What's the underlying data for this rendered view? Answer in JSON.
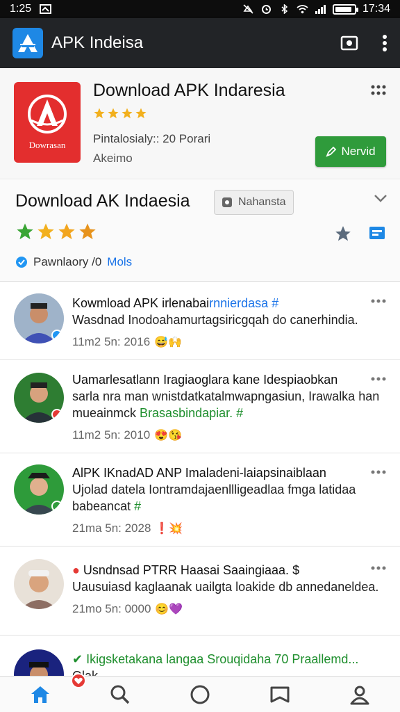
{
  "status_bar": {
    "time_left": "1:25",
    "time_right": "17:34",
    "battery_level": 0.9
  },
  "app_bar": {
    "title": "APK Indeisa",
    "icons": [
      "app-logo-icon",
      "screen-icon",
      "overflow-menu-icon"
    ]
  },
  "header": {
    "title": "Download APK Indaresia",
    "icon_caption": "Dowrasan",
    "rating": 4,
    "subtitle_1": "Pintalosialy:: 20 Porari",
    "subtitle_2": "Akeimo",
    "install_label": "Nervid"
  },
  "info": {
    "title": "Download AK Indaesia",
    "chip_label": "Nahansta",
    "rating": 4,
    "verified_text": "Pawnlaory /0",
    "verified_link": "Mols"
  },
  "posts": [
    {
      "title": "Kowmload APK irlenabai",
      "title_link": "rnnierdasa",
      "text": "Wasdnad Inodoahamurtagsiricgqah do canerhindia.",
      "meta": "11m2 5n: 2016",
      "emoji": "😅🙌"
    },
    {
      "title": "Uamarlesatlann Iragiaoglara kane Idespiaobkan",
      "text": "sarla nra man wnistdatkatalmwapngasiun, Irawalka han mueainmck",
      "text_link": "Brasasbindapiar.",
      "meta": "11m2 5n: 2010",
      "emoji": "😍😘"
    },
    {
      "title": "AlPK IKnadAD ANP Imaladeni-laiapsinaiblaan",
      "text": "Ujolad datela Iontramdajaenllligeadlaa fmga latidaa",
      "text2": "babeancat",
      "meta": "21ma 5n: 2028",
      "emoji": "❗💥"
    },
    {
      "title": "Usndnsad PTRR Haasai Saaingiaaa.",
      "text": "Uausuiasd kaglaanak uailgta loakide db annedaneldea.",
      "meta": "21mo 5n: 0000",
      "emoji": "😊💜"
    },
    {
      "title": "Ikigsketakana langaa",
      "title_link": "Srouqidaha 70 Praallemd...",
      "text": "Olak  "
    }
  ],
  "bottom_nav": [
    "home-icon",
    "search-icon",
    "circle-icon",
    "bookmark-icon",
    "profile-icon"
  ],
  "colors": {
    "app_bar": "#222427",
    "install_green": "#2f9b3b",
    "link_blue": "#1a73e8",
    "star_gold": "#f2b01e",
    "icon_red": "#e32e2e"
  }
}
